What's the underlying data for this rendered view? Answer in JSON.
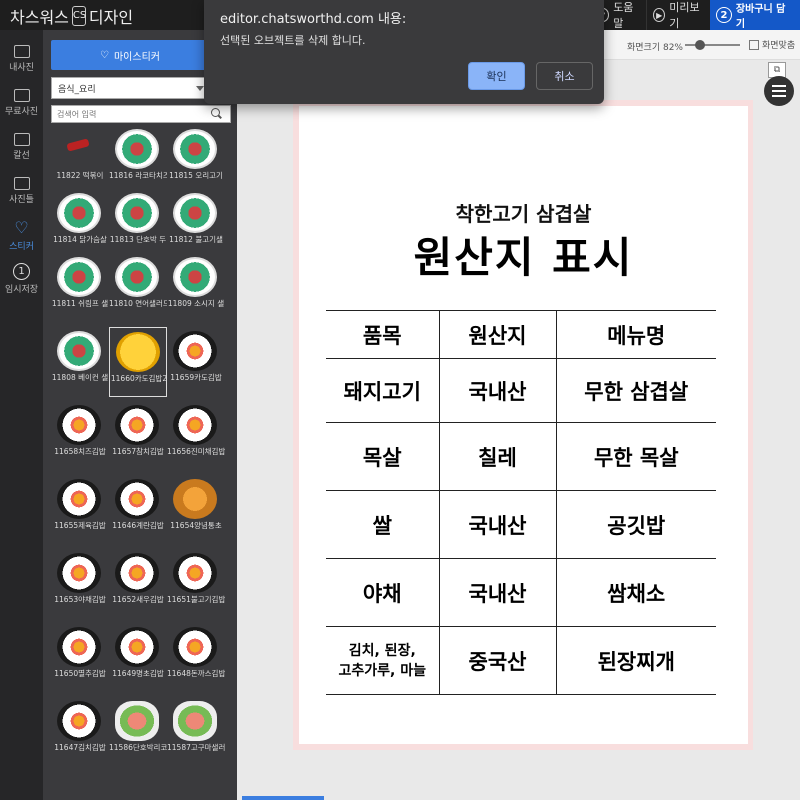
{
  "app": {
    "logo_left": "차스워스",
    "logo_mark": "CS",
    "logo_right": "디자인"
  },
  "top_buttons": {
    "help": "도움말",
    "preview": "미리보기",
    "cart": "장바구니 담기",
    "cart_step": "2"
  },
  "toolbar": {
    "zoom_label": "화면크기 82%",
    "fit_label": "화면맞춤",
    "stack_label": "⧉"
  },
  "leftnav": [
    {
      "label": "내사진",
      "icon": "photo-icon"
    },
    {
      "label": "무료사진",
      "icon": "free-photo-icon"
    },
    {
      "label": "칼선",
      "icon": "cutline-icon"
    },
    {
      "label": "사진틀",
      "icon": "frame-icon"
    },
    {
      "label": "스티커",
      "icon": "heart-icon",
      "active": true
    },
    {
      "label": "임시저장",
      "icon": "temp-save-icon",
      "num": "1"
    }
  ],
  "panel": {
    "my_sticker_label": "마이스티커",
    "category": "음식_요리",
    "grid_icon": "▦",
    "search_placeholder": "검색어 입력"
  },
  "stickers": [
    {
      "caption": "11822 떡볶이",
      "style": "stick"
    },
    {
      "caption": "11816 라코타치즈",
      "style": "bowl"
    },
    {
      "caption": "11815 오리고기",
      "style": "bowl"
    },
    {
      "caption": "11814 닭가슴살",
      "style": "bowl"
    },
    {
      "caption": "11813 단호박 두",
      "style": "bowl"
    },
    {
      "caption": "11812 불고기샐",
      "style": "bowl"
    },
    {
      "caption": "11811 쉬림프 샐",
      "style": "bowl"
    },
    {
      "caption": "11810 연어샐러드",
      "style": "bowl"
    },
    {
      "caption": "11809 소시지 샐",
      "style": "bowl"
    },
    {
      "caption": "11808 베이컨 샐",
      "style": "bowl"
    },
    {
      "caption": "11660카도김밥2",
      "style": "omelet",
      "selected": true
    },
    {
      "caption": "11659카도김밥",
      "style": "gimbap"
    },
    {
      "caption": "11658치즈김밥",
      "style": "gimbap"
    },
    {
      "caption": "11657참치김밥",
      "style": "gimbap"
    },
    {
      "caption": "11656진미채김밥",
      "style": "gimbap"
    },
    {
      "caption": "11655제육김밥",
      "style": "gimbap"
    },
    {
      "caption": "11646계란김밥",
      "style": "gimbap"
    },
    {
      "caption": "11654양념통초",
      "style": "fried"
    },
    {
      "caption": "11653야채김밥",
      "style": "gimbap"
    },
    {
      "caption": "11652새우김밥",
      "style": "gimbap"
    },
    {
      "caption": "11651불고기김밥",
      "style": "gimbap"
    },
    {
      "caption": "11650멸추김밥",
      "style": "gimbap"
    },
    {
      "caption": "11649명초김밥",
      "style": "gimbap"
    },
    {
      "caption": "11648돈까스김밥",
      "style": "gimbap"
    },
    {
      "caption": "11647김치김밥",
      "style": "gimbap"
    },
    {
      "caption": "11586단호박리코",
      "style": "plate"
    },
    {
      "caption": "11587고구마샐러",
      "style": "plate"
    }
  ],
  "poster": {
    "subtitle": "착한고기 삼겹살",
    "title": "원산지 표시",
    "rows": [
      {
        "item": "품목",
        "origin": "원산지",
        "menu": "메뉴명"
      },
      {
        "item": "돼지고기",
        "origin": "국내산",
        "menu": "무한 삼겹살"
      },
      {
        "item": "목살",
        "origin": "칠레",
        "menu": "무한 목살"
      },
      {
        "item": "쌀",
        "origin": "국내산",
        "menu": "공깃밥"
      },
      {
        "item": "야채",
        "origin": "국내산",
        "menu": "쌈채소"
      },
      {
        "item": "김치, 된장,\n고추가루, 마늘",
        "origin": "중국산",
        "menu": "된장찌개"
      }
    ]
  },
  "dialog": {
    "title": "editor.chatsworthd.com 내용:",
    "message": "선택된 오브젝트를 삭제 합니다.",
    "confirm": "확인",
    "cancel": "취소"
  }
}
